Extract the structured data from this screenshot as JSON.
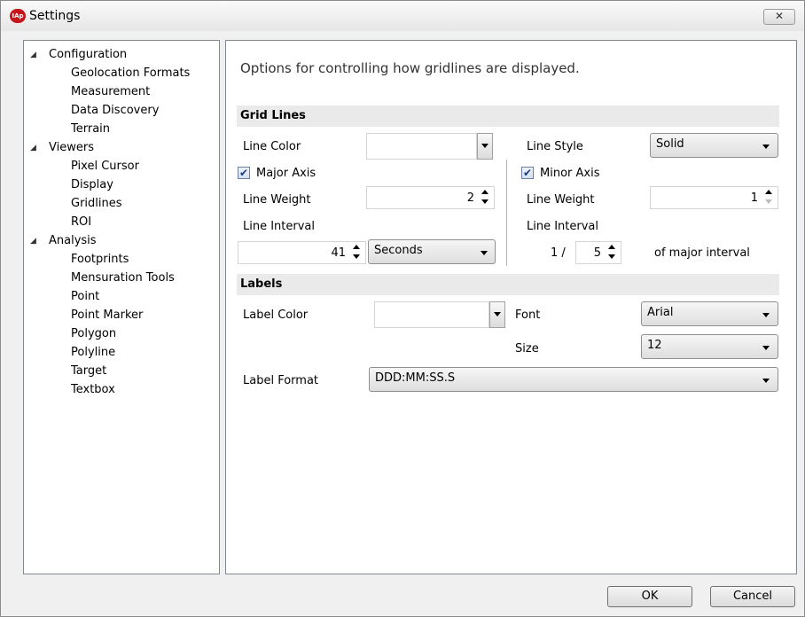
{
  "window": {
    "title": "Settings",
    "app_icon_text": "IAp",
    "close_symbol": "✕"
  },
  "tree": {
    "groups": [
      {
        "label": "Configuration",
        "children": [
          "Geolocation Formats",
          "Measurement",
          "Data Discovery",
          "Terrain"
        ]
      },
      {
        "label": "Viewers",
        "children": [
          "Pixel Cursor",
          "Display",
          "Gridlines",
          "ROI"
        ]
      },
      {
        "label": "Analysis",
        "children": [
          "Footprints",
          "Mensuration Tools",
          "Point",
          "Point Marker",
          "Polygon",
          "Polyline",
          "Target",
          "Textbox"
        ]
      }
    ],
    "expander_symbol": "◢"
  },
  "content": {
    "description": "Options for controlling how gridlines are displayed.",
    "grid_lines": {
      "header": "Grid Lines",
      "line_color_label": "Line Color",
      "line_style_label": "Line Style",
      "line_style_value": "Solid",
      "major_axis_label": "Major Axis",
      "major_axis_checked": true,
      "minor_axis_label": "Minor Axis",
      "minor_axis_checked": true,
      "major_line_weight_label": "Line Weight",
      "major_line_weight_value": "2",
      "minor_line_weight_label": "Line Weight",
      "minor_line_weight_value": "1",
      "major_line_interval_label": "Line Interval",
      "major_line_interval_value": "41",
      "major_interval_unit": "Seconds",
      "minor_line_interval_label": "Line Interval",
      "minor_interval_prefix": "1 /",
      "minor_interval_value": "5",
      "minor_interval_suffix": "of major interval"
    },
    "labels": {
      "header": "Labels",
      "label_color_label": "Label Color",
      "font_label": "Font",
      "font_value": "Arial",
      "size_label": "Size",
      "size_value": "12",
      "label_format_label": "Label Format",
      "label_format_value": "DDD:MM:SS.S"
    }
  },
  "buttons": {
    "ok": "OK",
    "cancel": "Cancel"
  },
  "check_mark": "✔"
}
